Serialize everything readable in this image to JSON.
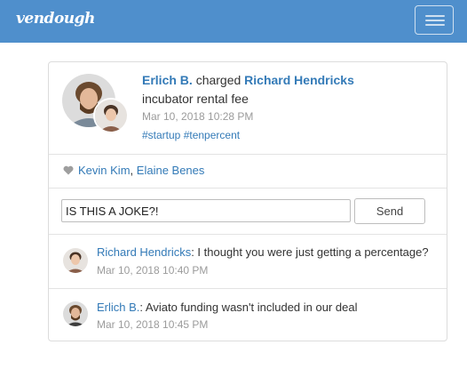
{
  "navbar": {
    "brand": "vendough",
    "menu_icon": "hamburger-icon"
  },
  "transaction": {
    "sender": "Erlich B.",
    "action": "charged",
    "recipient": "Richard Hendricks",
    "description": "incubator rental fee",
    "timestamp": "Mar 10, 2018 10:28 PM",
    "tag1": "#startup",
    "tag2": "#tenpercent"
  },
  "likes": {
    "icon": "heart-icon",
    "user1": "Kevin Kim",
    "separator": ",",
    "user2": "Elaine Benes"
  },
  "comment_form": {
    "value": "IS THIS A JOKE?!",
    "send_label": "Send"
  },
  "comments": [
    {
      "author": "Richard Hendricks",
      "text": ": I thought you were just getting a percentage?",
      "timestamp": "Mar 10, 2018 10:40 PM"
    },
    {
      "author": "Erlich B.",
      "text": ": Aviato funding wasn't included in our deal",
      "timestamp": "Mar 10, 2018 10:45 PM"
    }
  ]
}
